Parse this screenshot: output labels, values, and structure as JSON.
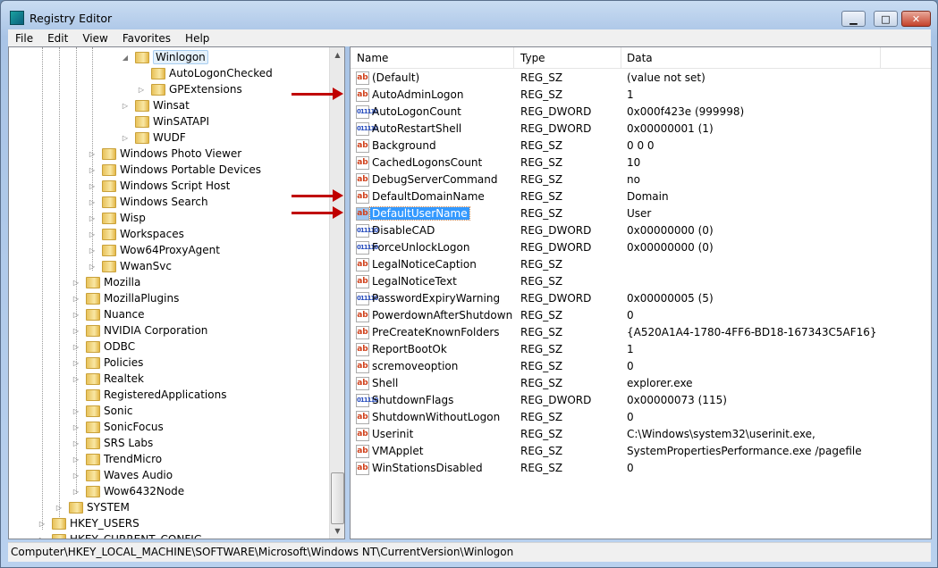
{
  "window": {
    "title": "Registry Editor",
    "minimize": "▁",
    "maximize": "□",
    "close": "✕"
  },
  "menu": [
    "File",
    "Edit",
    "View",
    "Favorites",
    "Help"
  ],
  "tree": [
    {
      "label": "Winlogon",
      "level": 4,
      "expander": "◢",
      "selected": true
    },
    {
      "label": "AutoLogonChecked",
      "level": 5,
      "expander": ""
    },
    {
      "label": "GPExtensions",
      "level": 5,
      "expander": "▷"
    },
    {
      "label": "Winsat",
      "level": 4,
      "expander": "▷"
    },
    {
      "label": "WinSATAPI",
      "level": 4,
      "expander": ""
    },
    {
      "label": "WUDF",
      "level": 4,
      "expander": "▷"
    },
    {
      "label": "Windows Photo Viewer",
      "level": 3,
      "expander": "▷"
    },
    {
      "label": "Windows Portable Devices",
      "level": 3,
      "expander": "▷"
    },
    {
      "label": "Windows Script Host",
      "level": 3,
      "expander": "▷"
    },
    {
      "label": "Windows Search",
      "level": 3,
      "expander": "▷"
    },
    {
      "label": "Wisp",
      "level": 3,
      "expander": "▷"
    },
    {
      "label": "Workspaces",
      "level": 3,
      "expander": "▷"
    },
    {
      "label": "Wow64ProxyAgent",
      "level": 3,
      "expander": "▷"
    },
    {
      "label": "WwanSvc",
      "level": 3,
      "expander": "▷"
    },
    {
      "label": "Mozilla",
      "level": 2,
      "expander": "▷"
    },
    {
      "label": "MozillaPlugins",
      "level": 2,
      "expander": "▷"
    },
    {
      "label": "Nuance",
      "level": 2,
      "expander": "▷"
    },
    {
      "label": "NVIDIA Corporation",
      "level": 2,
      "expander": "▷"
    },
    {
      "label": "ODBC",
      "level": 2,
      "expander": "▷"
    },
    {
      "label": "Policies",
      "level": 2,
      "expander": "▷"
    },
    {
      "label": "Realtek",
      "level": 2,
      "expander": "▷"
    },
    {
      "label": "RegisteredApplications",
      "level": 2,
      "expander": ""
    },
    {
      "label": "Sonic",
      "level": 2,
      "expander": "▷"
    },
    {
      "label": "SonicFocus",
      "level": 2,
      "expander": "▷"
    },
    {
      "label": "SRS Labs",
      "level": 2,
      "expander": "▷"
    },
    {
      "label": "TrendMicro",
      "level": 2,
      "expander": "▷"
    },
    {
      "label": "Waves Audio",
      "level": 2,
      "expander": "▷"
    },
    {
      "label": "Wow6432Node",
      "level": 2,
      "expander": "▷"
    },
    {
      "label": "SYSTEM",
      "level": 1,
      "expander": "▷"
    },
    {
      "label": "HKEY_USERS",
      "level": 0,
      "expander": "▷"
    },
    {
      "label": "HKEY_CURRENT_CONFIG",
      "level": 0,
      "expander": "▷"
    }
  ],
  "columns": {
    "name": "Name",
    "type": "Type",
    "data": "Data"
  },
  "values": [
    {
      "name": "(Default)",
      "type": "REG_SZ",
      "data": "(value not set)",
      "icon": "ab"
    },
    {
      "name": "AutoAdminLogon",
      "type": "REG_SZ",
      "data": "1",
      "icon": "ab",
      "arrow": true
    },
    {
      "name": "AutoLogonCount",
      "type": "REG_DWORD",
      "data": "0x000f423e (999998)",
      "icon": "dw"
    },
    {
      "name": "AutoRestartShell",
      "type": "REG_DWORD",
      "data": "0x00000001 (1)",
      "icon": "dw"
    },
    {
      "name": "Background",
      "type": "REG_SZ",
      "data": "0 0 0",
      "icon": "ab"
    },
    {
      "name": "CachedLogonsCount",
      "type": "REG_SZ",
      "data": "10",
      "icon": "ab"
    },
    {
      "name": "DebugServerCommand",
      "type": "REG_SZ",
      "data": "no",
      "icon": "ab"
    },
    {
      "name": "DefaultDomainName",
      "type": "REG_SZ",
      "data": "Domain",
      "icon": "ab",
      "arrow": true
    },
    {
      "name": "DefaultUserName",
      "type": "REG_SZ",
      "data": "User",
      "icon": "ab",
      "arrow": true,
      "selected": true
    },
    {
      "name": "DisableCAD",
      "type": "REG_DWORD",
      "data": "0x00000000 (0)",
      "icon": "dw"
    },
    {
      "name": "ForceUnlockLogon",
      "type": "REG_DWORD",
      "data": "0x00000000 (0)",
      "icon": "dw"
    },
    {
      "name": "LegalNoticeCaption",
      "type": "REG_SZ",
      "data": "",
      "icon": "ab"
    },
    {
      "name": "LegalNoticeText",
      "type": "REG_SZ",
      "data": "",
      "icon": "ab"
    },
    {
      "name": "PasswordExpiryWarning",
      "type": "REG_DWORD",
      "data": "0x00000005 (5)",
      "icon": "dw"
    },
    {
      "name": "PowerdownAfterShutdown",
      "type": "REG_SZ",
      "data": "0",
      "icon": "ab"
    },
    {
      "name": "PreCreateKnownFolders",
      "type": "REG_SZ",
      "data": "{A520A1A4-1780-4FF6-BD18-167343C5AF16}",
      "icon": "ab"
    },
    {
      "name": "ReportBootOk",
      "type": "REG_SZ",
      "data": "1",
      "icon": "ab"
    },
    {
      "name": "scremoveoption",
      "type": "REG_SZ",
      "data": "0",
      "icon": "ab"
    },
    {
      "name": "Shell",
      "type": "REG_SZ",
      "data": "explorer.exe",
      "icon": "ab"
    },
    {
      "name": "ShutdownFlags",
      "type": "REG_DWORD",
      "data": "0x00000073 (115)",
      "icon": "dw"
    },
    {
      "name": "ShutdownWithoutLogon",
      "type": "REG_SZ",
      "data": "0",
      "icon": "ab"
    },
    {
      "name": "Userinit",
      "type": "REG_SZ",
      "data": "C:\\Windows\\system32\\userinit.exe,",
      "icon": "ab"
    },
    {
      "name": "VMApplet",
      "type": "REG_SZ",
      "data": "SystemPropertiesPerformance.exe /pagefile",
      "icon": "ab"
    },
    {
      "name": "WinStationsDisabled",
      "type": "REG_SZ",
      "data": "0",
      "icon": "ab"
    }
  ],
  "status": "Computer\\HKEY_LOCAL_MACHINE\\SOFTWARE\\Microsoft\\Windows NT\\CurrentVersion\\Winlogon",
  "accent": "#3399ff",
  "arrow_color": "#c00000"
}
